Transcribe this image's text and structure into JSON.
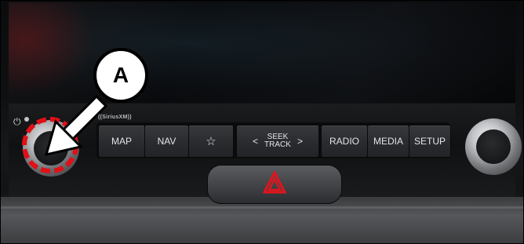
{
  "callout": {
    "label": "A"
  },
  "brand_strip": {
    "text": "((SiriusXM))"
  },
  "buttons": [
    {
      "id": "map",
      "label": "MAP"
    },
    {
      "id": "nav",
      "label": "NAV"
    },
    {
      "id": "favorite",
      "label": "☆",
      "icon": "star-icon"
    },
    {
      "id": "seek-track",
      "label_top": "SEEK",
      "label_bottom": "TRACK",
      "left": "<",
      "right": ">"
    },
    {
      "id": "radio",
      "label": "RADIO"
    },
    {
      "id": "media",
      "label": "MEDIA"
    },
    {
      "id": "setup",
      "label": "SETUP"
    }
  ],
  "icons": {
    "power": "power-icon",
    "hazard": "hazard-warning-icon",
    "callout_arrow": "arrow-icon"
  },
  "colors": {
    "highlight": "#e10f16",
    "hazard": "#e2141c"
  }
}
